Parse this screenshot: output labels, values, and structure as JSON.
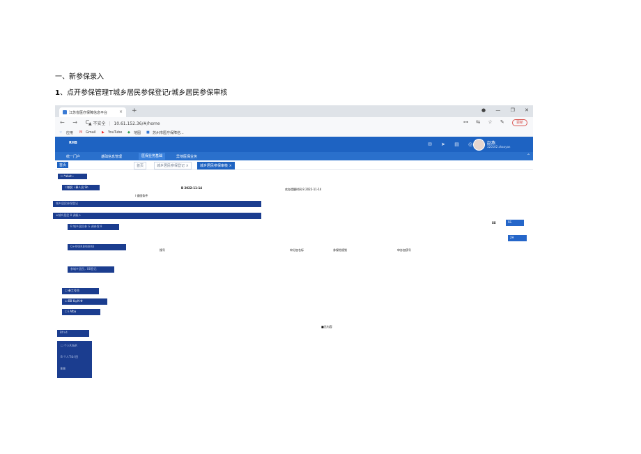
{
  "doc": {
    "heading1": "一、新参保录入",
    "heading2_num": "1",
    "heading2_text": "、点开参保管理T城乡居民参保登记r城乡居民参保审核"
  },
  "browser": {
    "tab_title": "江苏省医疗保障信息平台",
    "tab_close": "×",
    "new_tab": "+",
    "window_buttons": [
      "●",
      "—",
      "❐",
      "✕"
    ],
    "nav_buttons": [
      "←",
      "→",
      "C"
    ],
    "url_warning": "▲ 不安全",
    "url": "10.61.152.36/#/home",
    "address_icons": [
      "⊶",
      "⇆",
      "☆",
      "✎",
      "⋮"
    ],
    "update_label": "更新",
    "bookmarks": [
      "应用",
      "Gmail",
      "YouTube",
      "地图",
      "苏州市医疗保障信..."
    ]
  },
  "app": {
    "logo_text": "RHB",
    "header_icons": [
      "✉",
      "➤",
      "▤",
      "◎"
    ],
    "user_name": "赵燕",
    "user_role": "320102 zhaoyan",
    "menu": [
      "统一门户",
      "基础信息管理",
      "医保业务基础",
      "异地医保业务"
    ],
    "menu_active_index": 2,
    "collapse_icon": "⌃",
    "home_tab": "首页",
    "page_tabs": [
      "首页",
      "城乡居民参保登记 ×",
      "城乡居民参保审核 ×"
    ],
    "active_page_tab_index": 2
  },
  "content": {
    "left_tag": "☐ *abot~",
    "left_tag2": "☐按民 i 事人员 Sh",
    "date_left": "B 2022-11-14",
    "date_right": "欢办提醒时间 8 2022-11-14",
    "query_label": "i 查园条件",
    "bar1": "城乡居民参保登记",
    "bar2": "⊕城乡居民 8 调级⊙",
    "sub1": "B 城乡居民参 G 调参保 8",
    "sub2": "Q+RRBRBRBBRB",
    "sub3": "参城乡居民，BB登记",
    "right_s": "SS",
    "right_btn1": "SS",
    "right_btn2": "2H",
    "col_seq": "搜号",
    "col_name": "申分加名标",
    "col_plan": "参保险规划",
    "col_code": "申办加债号",
    "side1": "☐ 参工号目",
    "side2": "☐ BB 6以N Φ",
    "side3": "☐ i Afba",
    "empty": "■无内容",
    "side4": "Bfrn4",
    "side5": "☐ 个人Rll&R",
    "side6": "B 个人Ti&I 田",
    "side7": "B B"
  }
}
